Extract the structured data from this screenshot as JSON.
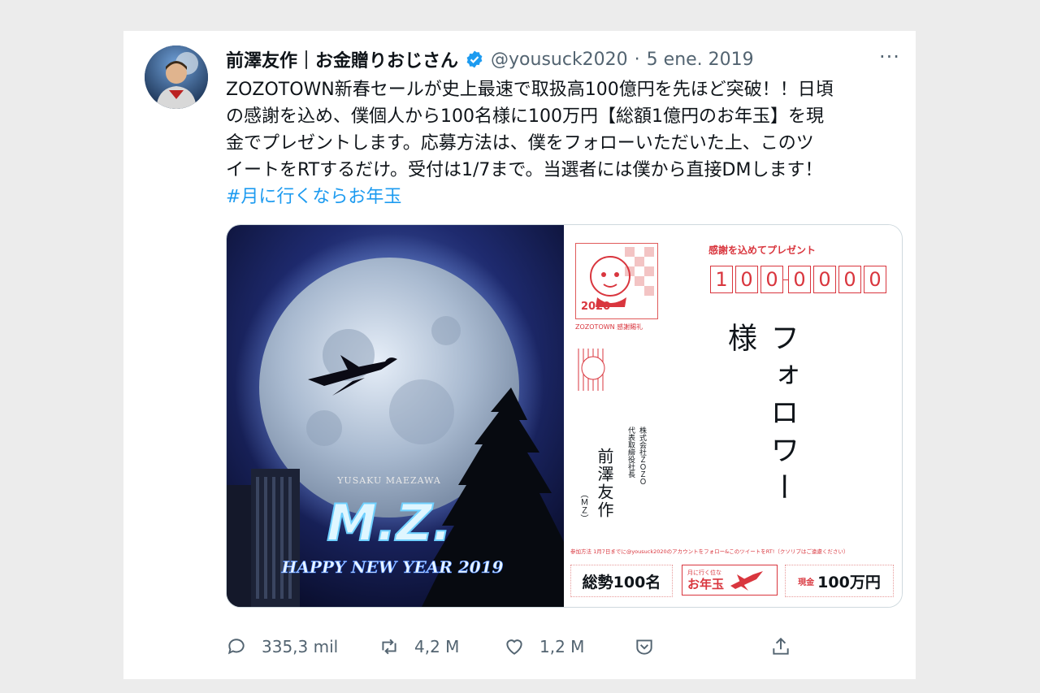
{
  "tweet": {
    "display_name": "前澤友作｜お金贈りおじさん",
    "handle": "@yousuck2020",
    "separator": "·",
    "date": "5 ene. 2019",
    "more_label": "···",
    "lines": [
      "ZOZOTOWN新春セールが史上最速で取扱高100億円を先ほど突破！！日頃",
      "の感謝を込め、僕個人から100名様に100万円【総額1億円のお年玉】を現",
      "金でプレゼントします。応募方法は、僕をフォローいただいた上、このツ",
      "イートをRTするだけ。受付は1/7まで。当選者には僕から直接DMします！"
    ],
    "hashtag": "#月に行くならお年玉"
  },
  "image": {
    "subtitle": "YUSAKU MAEZAWA",
    "logo": "M.Z.",
    "greeting": "HAPPY NEW YEAR 2019",
    "card_header": "感謝を込めてプレゼント",
    "postal_digits": [
      "1",
      "0",
      "0",
      "0",
      "0",
      "0",
      "0"
    ],
    "stamp_year": "2020",
    "stamp_caption": "ZOZOTOWN 感謝賜礼",
    "recipient": "フォロワー様",
    "sender_company": "株式会社ＺＯＺＯ",
    "sender_title": "代表取締役社長",
    "sender_name": "前澤友作",
    "sender_initials": "（ＭＺ）",
    "footnote": "参加方法 1月7日までに@yousuck2020のアカウントをフォロー&このツイートをRT!（クソリプはご遠慮ください）",
    "box_left": "総勢100名",
    "box_mid_small": "月に行く位な",
    "box_mid": "お年玉",
    "box_right_small": "現金",
    "box_right": "100万円"
  },
  "actions": {
    "reply_count": "335,3 mil",
    "retweet_count": "4,2 M",
    "like_count": "1,2 M"
  },
  "colors": {
    "link": "#1d9bf0",
    "verified": "#1d9bf0",
    "card_red": "#d9363e",
    "muted": "#536471"
  }
}
